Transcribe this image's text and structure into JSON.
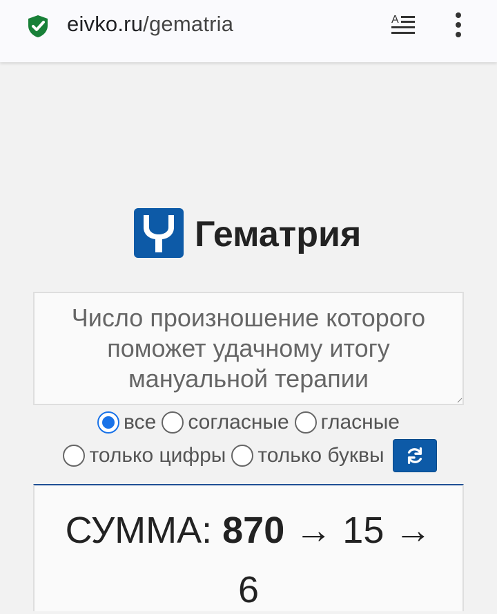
{
  "browser": {
    "url_host": "eivko.ru",
    "url_path": "/gematria"
  },
  "header": {
    "title": "Гематрия"
  },
  "input": {
    "text": "Число произношение которого поможет удачному итогу мануальной терапии"
  },
  "options": {
    "all": "все",
    "consonants": "согласные",
    "vowels": "гласные",
    "digits_only": "только цифры",
    "letters_only": "только буквы",
    "selected": "все"
  },
  "result": {
    "label": "СУММА:",
    "sum": "870",
    "arrow1": "→",
    "reduced1": "15",
    "arrow2": "→",
    "reduced2": "6"
  },
  "colors": {
    "brand_blue": "#0d5aa7",
    "shield_green": "#188038",
    "radio_blue": "#1a73e8"
  }
}
